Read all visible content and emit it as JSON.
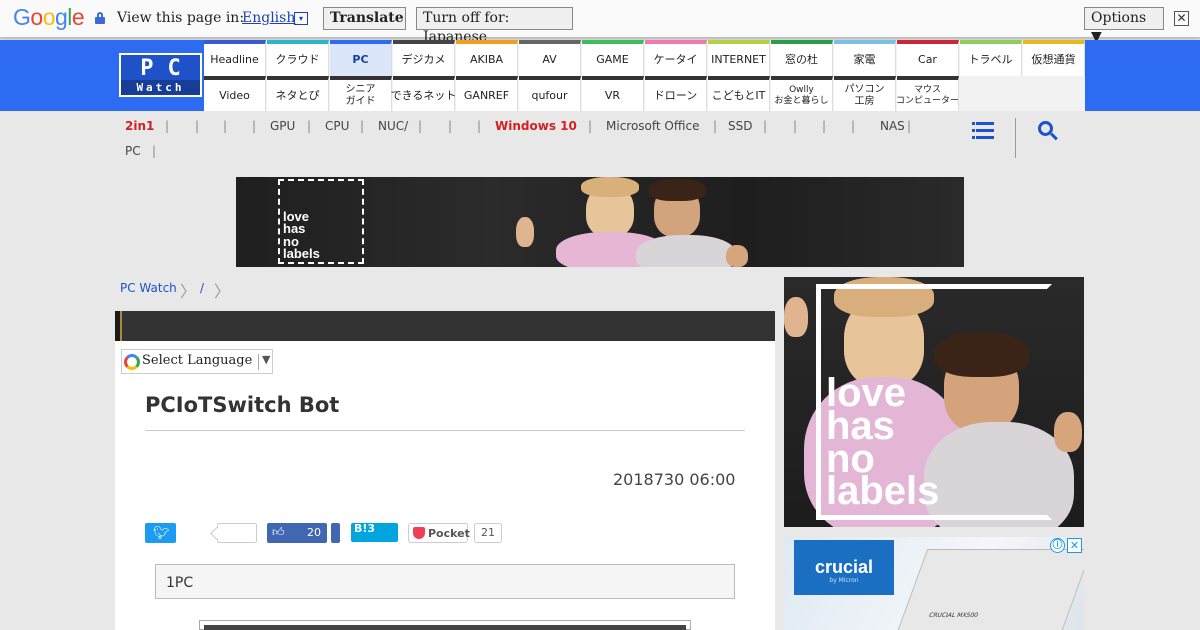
{
  "translate_bar": {
    "logo": "Google",
    "prompt": "View this page in:",
    "language": "English",
    "language_arrow": "▾",
    "translate_label": "Translate",
    "turn_off_label": "Turn off for: Japanese",
    "options_label": "Options ▼",
    "close_label": "✕"
  },
  "site": {
    "logo_top": "PC",
    "logo_bottom": "Watch"
  },
  "nav": {
    "row1": [
      {
        "label": "Headline",
        "color": "#3a5bd0"
      },
      {
        "label": "クラウド",
        "color": "#2bb5c8"
      },
      {
        "label": "PC",
        "color": "#2d6bf3"
      },
      {
        "label": "デジカメ",
        "color": "#444444"
      },
      {
        "label": "AKIBA",
        "color": "#f0a020"
      },
      {
        "label": "AV",
        "color": "#666666"
      },
      {
        "label": "GAME",
        "color": "#3cbf5a"
      },
      {
        "label": "ケータイ",
        "color": "#f07ab0"
      },
      {
        "label": "INTERNET",
        "color": "#b5d045"
      },
      {
        "label": "窓の杜",
        "color": "#2a9d4a"
      },
      {
        "label": "家電",
        "color": "#7ac0e8"
      },
      {
        "label": "Car",
        "color": "#c8283a"
      },
      {
        "label": "トラベル",
        "color": "#8dcf5a"
      },
      {
        "label": "仮想通貨",
        "color": "#e8b820"
      }
    ],
    "row2": [
      {
        "label": "Video"
      },
      {
        "label": "ネタとぴ"
      },
      {
        "label": "シニア\nガイド"
      },
      {
        "label": "できるネット"
      },
      {
        "label": "GANREF"
      },
      {
        "label": "qufour"
      },
      {
        "label": "VR"
      },
      {
        "label": "ドローン"
      },
      {
        "label": "こどもとIT"
      },
      {
        "label": "Owlly\nお金と暮らし"
      },
      {
        "label": "パソコン\n工房"
      },
      {
        "label": "マウス\nコンピューター"
      }
    ],
    "active": "PC"
  },
  "subnav": {
    "items": [
      "2in1",
      "GPU",
      "CPU",
      "NUC/",
      "Windows 10",
      "Microsoft Office",
      "SSD",
      "NAS",
      "PC"
    ],
    "separator": "|"
  },
  "ads": {
    "banner_text": "love\nhas\nno\nlabels",
    "side_text": "love\nhas\nno\nlabels",
    "crucial_brand": "crucial",
    "crucial_sub": "by Micron",
    "ssd_label": "CRUCIAL MX500",
    "info": "ⓘ",
    "close": "✕"
  },
  "breadcrumb": [
    "PC Watch",
    "/"
  ],
  "article": {
    "language_select": "Select Language",
    "language_arrow": "▼",
    "title": "PCIoTSwitch Bot",
    "date": "2018730 06:00",
    "share": {
      "twitter_icon": "twitter-bird-icon",
      "fb_count": "20",
      "hatena": "B!3",
      "pocket": "Pocket",
      "pocket_count": "21"
    },
    "lead": "1PC"
  }
}
